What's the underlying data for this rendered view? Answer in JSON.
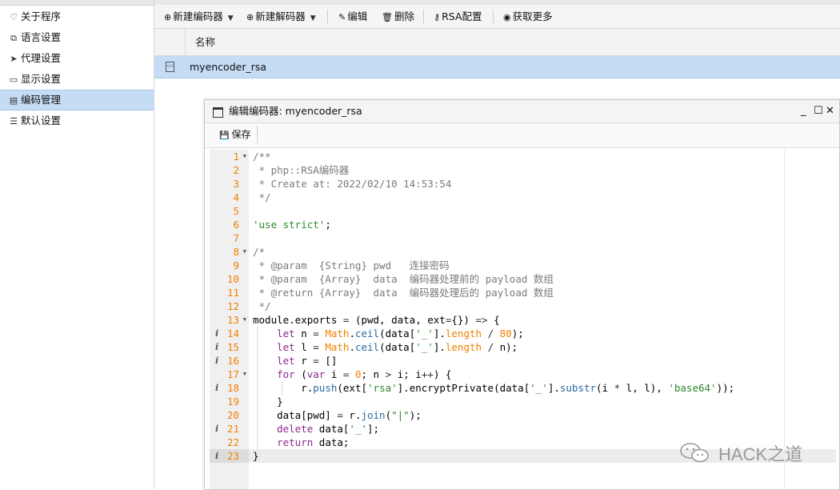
{
  "sidebar": {
    "items": [
      {
        "label": "关于程序",
        "icon": "heart-icon"
      },
      {
        "label": "语言设置",
        "icon": "language-icon"
      },
      {
        "label": "代理设置",
        "icon": "send-icon"
      },
      {
        "label": "显示设置",
        "icon": "monitor-icon"
      },
      {
        "label": "编码管理",
        "icon": "file-code-icon",
        "active": true
      },
      {
        "label": "默认设置",
        "icon": "sliders-icon"
      }
    ]
  },
  "toolbar": {
    "new_encoder": "新建编码器",
    "new_decoder": "新建解码器",
    "edit": "编辑",
    "delete": "删除",
    "rsa_config": "RSA配置",
    "get_more": "获取更多"
  },
  "grid": {
    "column_name": "名称",
    "rows": [
      "myencoder_rsa"
    ]
  },
  "window": {
    "title": "编辑编码器: myencoder_rsa",
    "save_label": "保存"
  },
  "editor": {
    "current_line": 23,
    "lines": [
      {
        "n": "1",
        "fold": true,
        "info": false,
        "text": "/**"
      },
      {
        "n": "2",
        "fold": false,
        "info": false,
        "text": " * php::RSA编码器"
      },
      {
        "n": "3",
        "fold": false,
        "info": false,
        "text": " * Create at: 2022/02/10 14:53:54"
      },
      {
        "n": "4",
        "fold": false,
        "info": false,
        "text": " */"
      },
      {
        "n": "5",
        "fold": false,
        "info": false,
        "text": ""
      },
      {
        "n": "6",
        "fold": false,
        "info": false,
        "text": "'use strict';"
      },
      {
        "n": "7",
        "fold": false,
        "info": false,
        "text": ""
      },
      {
        "n": "8",
        "fold": true,
        "info": false,
        "text": "/*"
      },
      {
        "n": "9",
        "fold": false,
        "info": false,
        "text": " * @param  {String} pwd   连接密码"
      },
      {
        "n": "10",
        "fold": false,
        "info": false,
        "text": " * @param  {Array}  data  编码器处理前的 payload 数组"
      },
      {
        "n": "11",
        "fold": false,
        "info": false,
        "text": " * @return {Array}  data  编码器处理后的 payload 数组"
      },
      {
        "n": "12",
        "fold": false,
        "info": false,
        "text": " */"
      },
      {
        "n": "13",
        "fold": true,
        "info": false,
        "text": "module.exports = (pwd, data, ext={}) => {"
      },
      {
        "n": "14",
        "fold": false,
        "info": true,
        "text": "    let n = Math.ceil(data['_'].length / 80);"
      },
      {
        "n": "15",
        "fold": false,
        "info": true,
        "text": "    let l = Math.ceil(data['_'].length / n);"
      },
      {
        "n": "16",
        "fold": false,
        "info": true,
        "text": "    let r = []"
      },
      {
        "n": "17",
        "fold": true,
        "info": false,
        "text": "    for (var i = 0; n > i; i++) {"
      },
      {
        "n": "18",
        "fold": false,
        "info": true,
        "text": "        r.push(ext['rsa'].encryptPrivate(data['_'].substr(i * l, l), 'base64'));"
      },
      {
        "n": "19",
        "fold": false,
        "info": false,
        "text": "    }"
      },
      {
        "n": "20",
        "fold": false,
        "info": false,
        "text": "    data[pwd] = r.join(\"|\");"
      },
      {
        "n": "21",
        "fold": false,
        "info": true,
        "text": "    delete data['_'];"
      },
      {
        "n": "22",
        "fold": false,
        "info": false,
        "text": "    return data;"
      },
      {
        "n": "23",
        "fold": false,
        "info": true,
        "text": "}"
      }
    ]
  },
  "watermark": {
    "text": "HACK之道"
  }
}
